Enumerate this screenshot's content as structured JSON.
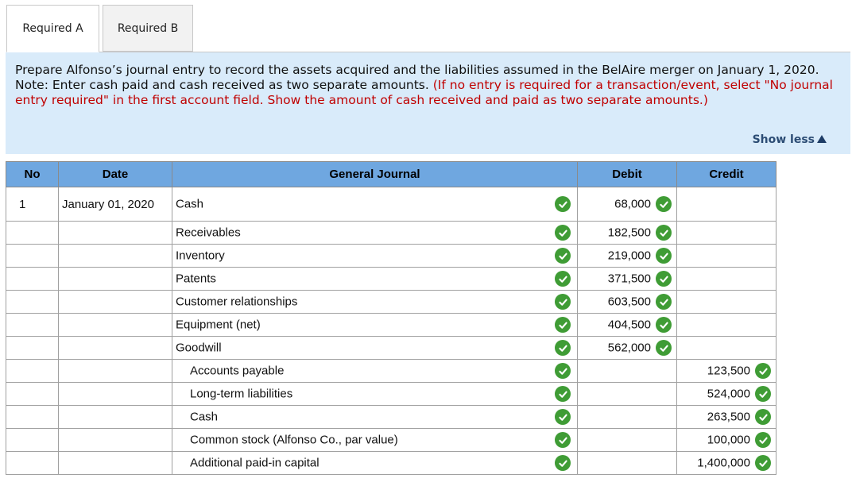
{
  "tabs": [
    {
      "label": "Required A"
    },
    {
      "label": "Required B"
    }
  ],
  "instructions": {
    "main": "Prepare Alfonso’s journal entry to record the assets acquired and the liabilities assumed in the BelAire merger on January 1, 2020. Note: Enter cash paid and cash received as two separate amounts.",
    "note": "(If no entry is required for a transaction/event, select \"No journal entry required\" in the first account field. Show the amount of cash received and paid as two separate amounts.)",
    "show_less": "Show less"
  },
  "table": {
    "headers": {
      "no": "No",
      "date": "Date",
      "journal": "General Journal",
      "debit": "Debit",
      "credit": "Credit"
    },
    "rows": [
      {
        "no": "1",
        "date": "January 01, 2020",
        "account": "Cash",
        "debit": "68,000",
        "credit": ""
      },
      {
        "no": "",
        "date": "",
        "account": "Receivables",
        "debit": "182,500",
        "credit": ""
      },
      {
        "no": "",
        "date": "",
        "account": "Inventory",
        "debit": "219,000",
        "credit": ""
      },
      {
        "no": "",
        "date": "",
        "account": "Patents",
        "debit": "371,500",
        "credit": ""
      },
      {
        "no": "",
        "date": "",
        "account": "Customer relationships",
        "debit": "603,500",
        "credit": ""
      },
      {
        "no": "",
        "date": "",
        "account": "Equipment (net)",
        "debit": "404,500",
        "credit": ""
      },
      {
        "no": "",
        "date": "",
        "account": "Goodwill",
        "debit": "562,000",
        "credit": ""
      },
      {
        "no": "",
        "date": "",
        "account": "Accounts payable",
        "debit": "",
        "credit": "123,500"
      },
      {
        "no": "",
        "date": "",
        "account": "Long-term liabilities",
        "debit": "",
        "credit": "524,000"
      },
      {
        "no": "",
        "date": "",
        "account": "Cash",
        "debit": "",
        "credit": "263,500"
      },
      {
        "no": "",
        "date": "",
        "account": "Common stock (Alfonso Co., par value)",
        "debit": "",
        "credit": "100,000"
      },
      {
        "no": "",
        "date": "",
        "account": "Additional paid-in capital",
        "debit": "",
        "credit": "1,400,000"
      }
    ]
  },
  "colors": {
    "header_bg": "#6fa7e0",
    "instructions_bg": "#d9ebfa",
    "check_green": "#3f9c35",
    "note_red": "#c00000"
  },
  "icons": {
    "check": "check-circle-icon",
    "show_less": "triangle-up-icon"
  }
}
